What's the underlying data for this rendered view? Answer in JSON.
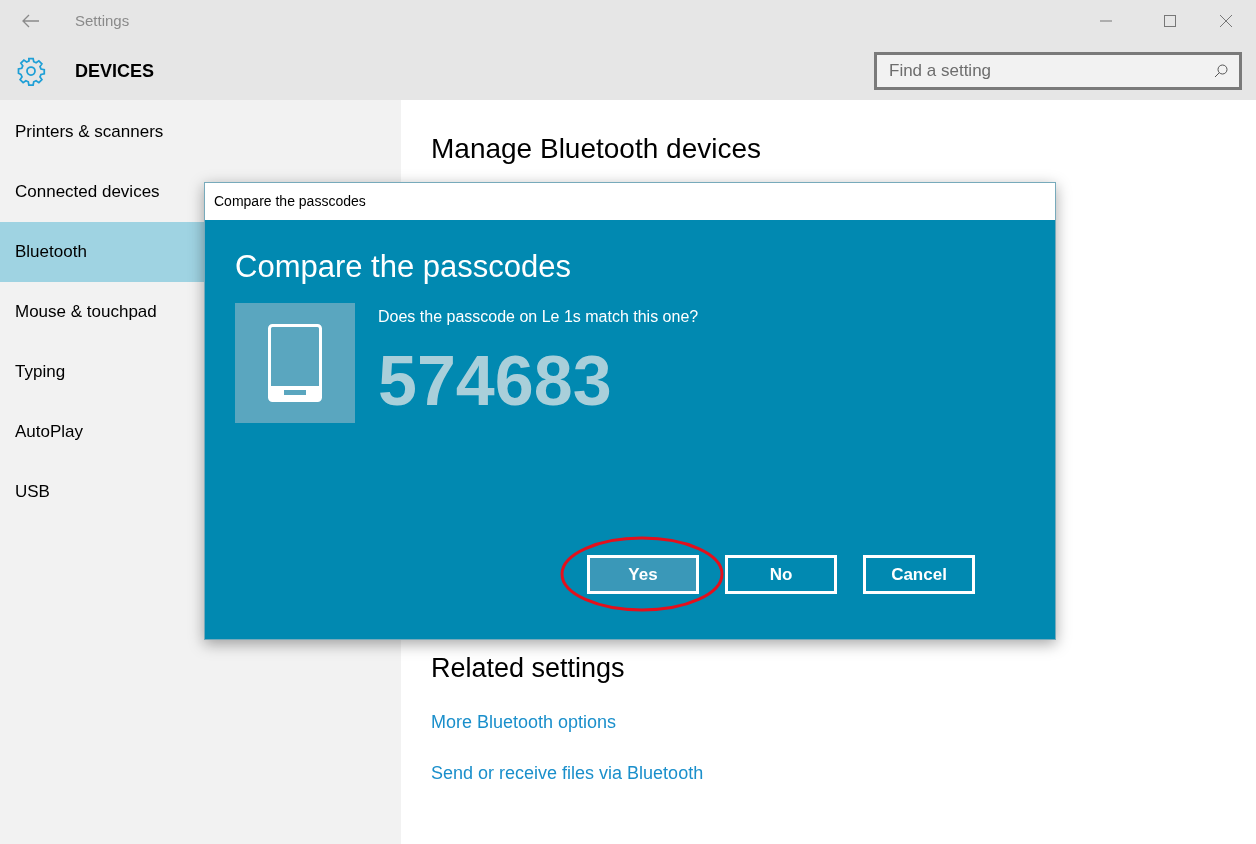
{
  "window": {
    "title": "Settings"
  },
  "header": {
    "title": "DEVICES",
    "search": {
      "placeholder": "Find a setting"
    }
  },
  "sidebar": {
    "items": [
      {
        "label": "Printers & scanners",
        "selected": false
      },
      {
        "label": "Connected devices",
        "selected": false
      },
      {
        "label": "Bluetooth",
        "selected": true
      },
      {
        "label": "Mouse & touchpad",
        "selected": false
      },
      {
        "label": "Typing",
        "selected": false
      },
      {
        "label": "AutoPlay",
        "selected": false
      },
      {
        "label": "USB",
        "selected": false
      }
    ]
  },
  "content": {
    "heading": "Manage Bluetooth devices",
    "related": {
      "heading": "Related settings",
      "links": [
        "More Bluetooth options",
        "Send or receive files via Bluetooth"
      ]
    }
  },
  "dialog": {
    "title": "Compare the passcodes",
    "heading": "Compare the passcodes",
    "question": "Does the passcode on Le 1s match this one?",
    "passcode": "574683",
    "buttons": [
      {
        "label": "Yes",
        "focused": true,
        "circled": true
      },
      {
        "label": "No",
        "focused": false,
        "circled": false
      },
      {
        "label": "Cancel",
        "focused": false,
        "circled": false
      }
    ]
  }
}
